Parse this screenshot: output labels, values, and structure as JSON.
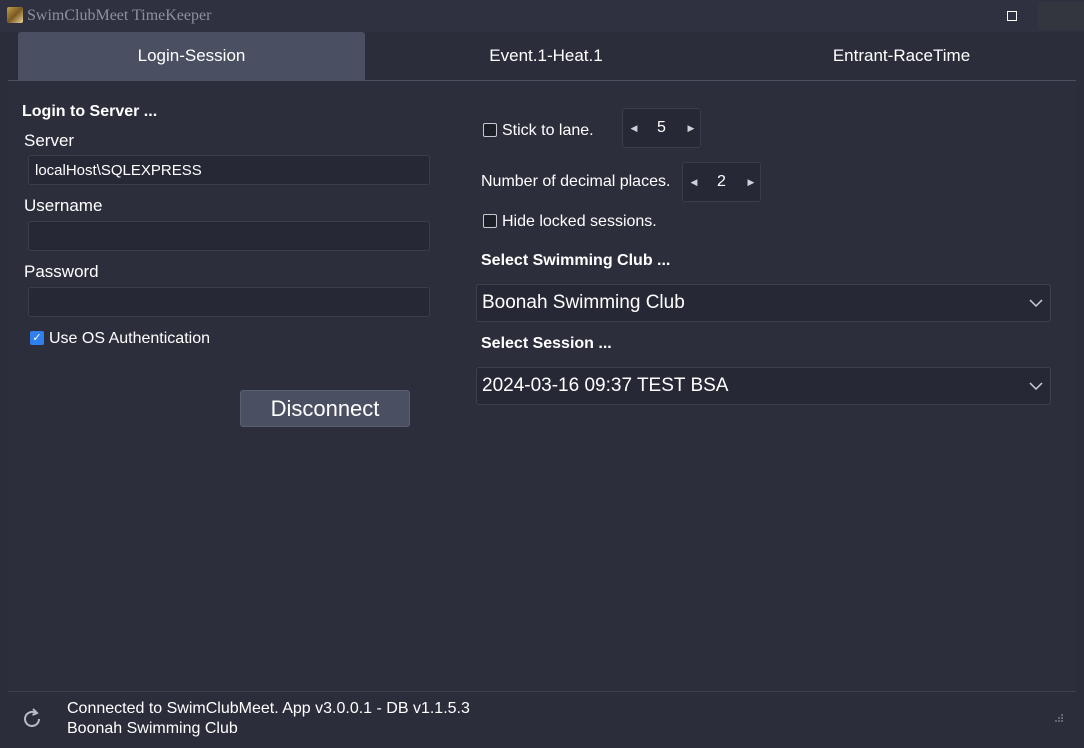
{
  "window": {
    "title": "SwimClubMeet TimeKeeper"
  },
  "tabs": [
    {
      "label": "Login-Session",
      "active": true
    },
    {
      "label": "Event.1-Heat.1",
      "active": false
    },
    {
      "label": "Entrant-RaceTime",
      "active": false
    }
  ],
  "login": {
    "heading": "Login to Server ...",
    "server_label": "Server",
    "server_value": "localHost\\SQLEXPRESS",
    "username_label": "Username",
    "username_value": "",
    "password_label": "Password",
    "password_value": "",
    "os_auth_label": "Use OS Authentication",
    "os_auth_checked": true,
    "disconnect_label": "Disconnect"
  },
  "options": {
    "stick_lane_label": "Stick to lane.",
    "stick_lane_checked": false,
    "lane_value": "5",
    "decimal_label": "Number of decimal places.",
    "decimal_value": "2",
    "hide_locked_label": "Hide locked sessions.",
    "hide_locked_checked": false,
    "club_heading": "Select Swimming Club ...",
    "club_value": "Boonah Swimming Club",
    "session_heading": "Select Session ...",
    "session_value": "2024-03-16 09:37 TEST BSA"
  },
  "status": {
    "line1": "Connected to SwimClubMeet. App v3.0.0.1 - DB v1.1.5.3",
    "line2": "Boonah Swimming Club"
  },
  "colors": {
    "background": "#2b2d3b",
    "active_tab": "#4a5062",
    "field_bg": "#262836",
    "checkbox_checked": "#2f80ed"
  }
}
